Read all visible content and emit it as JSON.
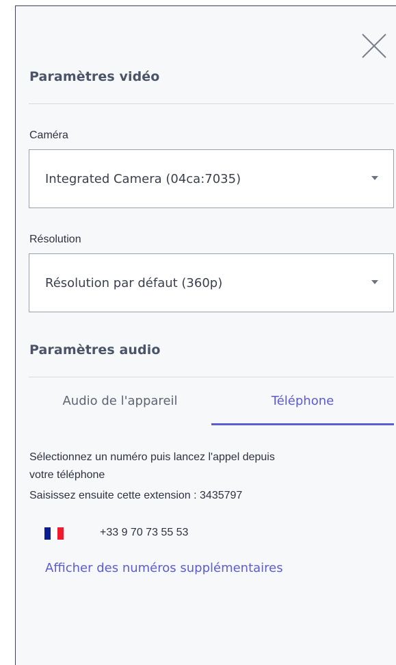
{
  "close": {
    "icon": "close-icon"
  },
  "video": {
    "title": "Paramètres vidéo",
    "camera_label": "Caméra",
    "camera_value": "Integrated Camera (04ca:7035)",
    "resolution_label": "Résolution",
    "resolution_value": "Résolution par défaut (360p)"
  },
  "audio": {
    "title": "Paramètres audio",
    "tabs": [
      {
        "label": "Audio de l'appareil",
        "active": false
      },
      {
        "label": "Téléphone",
        "active": true
      }
    ],
    "instructions_line1": "Sélectionnez un numéro puis lancez l'appel depuis",
    "instructions_line2": "votre téléphone",
    "extension_text": "Saisissez ensuite cette extension : 3435797",
    "phone": {
      "country_flag_icon": "france-flag-icon",
      "number": "+33 9 70 73 55 53"
    },
    "more_numbers_link": "Afficher des numéros supplémentaires"
  },
  "colors": {
    "accent": "#5b5bd6",
    "flag_blue": "#0a1f8f",
    "flag_white": "#ffffff",
    "flag_red": "#ef1b2d"
  }
}
